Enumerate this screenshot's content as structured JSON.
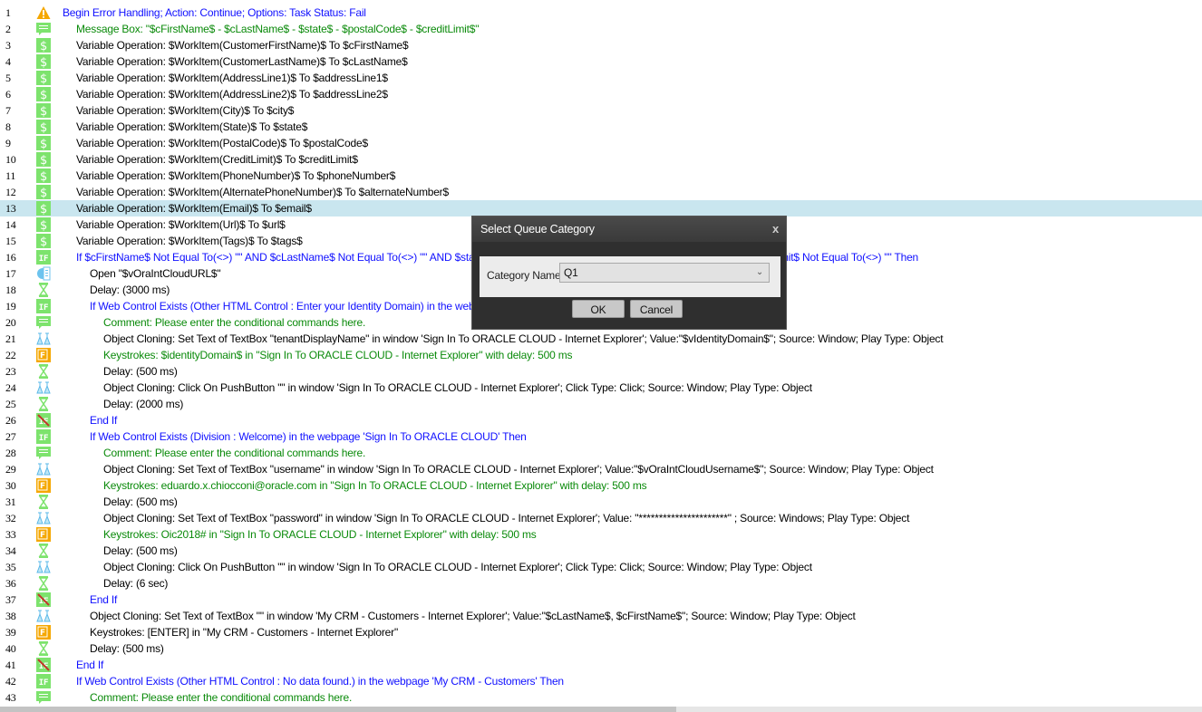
{
  "colors": {
    "blue": "#1010ff",
    "green": "#0a8a0a",
    "selected_row": "#c9e6ef"
  },
  "rows": [
    {
      "n": "1",
      "icon": "warning",
      "indent": 0,
      "color": "blue",
      "text": "Begin Error Handling; Action: Continue; Options:  Task Status: Fail"
    },
    {
      "n": "2",
      "icon": "comment",
      "indent": 1,
      "color": "green",
      "text": "Message Box: \"$cFirstName$ - $cLastName$ - $state$ - $postalCode$ - $creditLimit$\""
    },
    {
      "n": "3",
      "icon": "dollar",
      "indent": 1,
      "color": "black",
      "text": "Variable Operation: $WorkItem(CustomerFirstName)$ To $cFirstName$"
    },
    {
      "n": "4",
      "icon": "dollar",
      "indent": 1,
      "color": "black",
      "text": "Variable Operation: $WorkItem(CustomerLastName)$ To $cLastName$"
    },
    {
      "n": "5",
      "icon": "dollar",
      "indent": 1,
      "color": "black",
      "text": "Variable Operation: $WorkItem(AddressLine1)$ To $addressLine1$"
    },
    {
      "n": "6",
      "icon": "dollar",
      "indent": 1,
      "color": "black",
      "text": "Variable Operation: $WorkItem(AddressLine2)$ To $addressLine2$"
    },
    {
      "n": "7",
      "icon": "dollar",
      "indent": 1,
      "color": "black",
      "text": "Variable Operation: $WorkItem(City)$ To $city$"
    },
    {
      "n": "8",
      "icon": "dollar",
      "indent": 1,
      "color": "black",
      "text": "Variable Operation: $WorkItem(State)$ To $state$"
    },
    {
      "n": "9",
      "icon": "dollar",
      "indent": 1,
      "color": "black",
      "text": "Variable Operation: $WorkItem(PostalCode)$ To $postalCode$"
    },
    {
      "n": "10",
      "icon": "dollar",
      "indent": 1,
      "color": "black",
      "text": "Variable Operation: $WorkItem(CreditLimit)$ To $creditLimit$"
    },
    {
      "n": "11",
      "icon": "dollar",
      "indent": 1,
      "color": "black",
      "text": "Variable Operation: $WorkItem(PhoneNumber)$ To $phoneNumber$"
    },
    {
      "n": "12",
      "icon": "dollar",
      "indent": 1,
      "color": "black",
      "text": "Variable Operation: $WorkItem(AlternatePhoneNumber)$ To $alternateNumber$"
    },
    {
      "n": "13",
      "icon": "dollar",
      "indent": 1,
      "color": "black",
      "text": "Variable Operation: $WorkItem(Email)$ To $email$",
      "selected": true
    },
    {
      "n": "14",
      "icon": "dollar",
      "indent": 1,
      "color": "black",
      "text": "Variable Operation: $WorkItem(Url)$ To $url$"
    },
    {
      "n": "15",
      "icon": "dollar",
      "indent": 1,
      "color": "black",
      "text": "Variable Operation: $WorkItem(Tags)$ To $tags$"
    },
    {
      "n": "16",
      "icon": "if",
      "indent": 1,
      "color": "blue",
      "text": "If $cFirstName$ Not Equal To(<>) \"\" AND $cLastName$ Not Equal To(<>) \"\" AND $state$ N",
      "tail": "mit$ Not Equal To(<>) \"\" Then"
    },
    {
      "n": "17",
      "icon": "open",
      "indent": 2,
      "color": "black",
      "text": "Open \"$vOraIntCloudURL$\""
    },
    {
      "n": "18",
      "icon": "delay",
      "indent": 2,
      "color": "black",
      "text": "Delay: (3000 ms)"
    },
    {
      "n": "19",
      "icon": "if",
      "indent": 2,
      "color": "blue",
      "text": "If Web Control Exists (Other HTML Control : Enter your Identity Domain) in the webpage 'S"
    },
    {
      "n": "20",
      "icon": "comment",
      "indent": 3,
      "color": "green",
      "text": "Comment: Please enter the conditional commands here."
    },
    {
      "n": "21",
      "icon": "clone",
      "indent": 3,
      "color": "black",
      "text": "Object Cloning: Set Text of TextBox \"tenantDisplayName\" in window 'Sign In To ORACLE CLOUD - Internet Explorer'; Value:\"$vIdentityDomain$\"; Source: Window; Play Type: Object"
    },
    {
      "n": "22",
      "icon": "keys",
      "indent": 3,
      "color": "green",
      "text": "Keystrokes: $identityDomain$ in \"Sign In To ORACLE CLOUD - Internet Explorer\" with delay: 500 ms"
    },
    {
      "n": "23",
      "icon": "delay",
      "indent": 3,
      "color": "black",
      "text": "Delay: (500 ms)"
    },
    {
      "n": "24",
      "icon": "clone",
      "indent": 3,
      "color": "black",
      "text": "Object Cloning: Click On PushButton \"\" in window 'Sign In To ORACLE CLOUD - Internet Explorer'; Click Type: Click; Source: Window; Play Type: Object"
    },
    {
      "n": "25",
      "icon": "delay",
      "indent": 3,
      "color": "black",
      "text": "Delay: (2000 ms)"
    },
    {
      "n": "26",
      "icon": "endif",
      "indent": 2,
      "color": "blue",
      "text": "End If"
    },
    {
      "n": "27",
      "icon": "if",
      "indent": 2,
      "color": "blue",
      "text": "If Web Control Exists (Division : Welcome) in the webpage 'Sign In To ORACLE CLOUD' Then"
    },
    {
      "n": "28",
      "icon": "comment",
      "indent": 3,
      "color": "green",
      "text": "Comment: Please enter the conditional commands here."
    },
    {
      "n": "29",
      "icon": "clone",
      "indent": 3,
      "color": "black",
      "text": "Object Cloning: Set Text of TextBox \"username\" in window 'Sign In To ORACLE CLOUD - Internet Explorer'; Value:\"$vOraIntCloudUsername$\"; Source: Window; Play Type: Object"
    },
    {
      "n": "30",
      "icon": "keys",
      "indent": 3,
      "color": "green",
      "text": "Keystrokes: eduardo.x.chiocconi@oracle.com in \"Sign In To ORACLE CLOUD - Internet Explorer\" with delay: 500 ms"
    },
    {
      "n": "31",
      "icon": "delay",
      "indent": 3,
      "color": "black",
      "text": "Delay: (500 ms)"
    },
    {
      "n": "32",
      "icon": "clone",
      "indent": 3,
      "color": "black",
      "text": "Object Cloning: Set Text of TextBox \"password\" in window 'Sign In To ORACLE CLOUD - Internet Explorer'; Value: \"**********************\" ; Source: Windows; Play Type: Object"
    },
    {
      "n": "33",
      "icon": "keys",
      "indent": 3,
      "color": "green",
      "text": "Keystrokes: Oic2018# in \"Sign In To ORACLE CLOUD - Internet Explorer\" with delay: 500 ms"
    },
    {
      "n": "34",
      "icon": "delay",
      "indent": 3,
      "color": "black",
      "text": "Delay: (500 ms)"
    },
    {
      "n": "35",
      "icon": "clone",
      "indent": 3,
      "color": "black",
      "text": "Object Cloning: Click On PushButton \"\" in window 'Sign In To ORACLE CLOUD - Internet Explorer'; Click Type: Click; Source: Window; Play Type: Object"
    },
    {
      "n": "36",
      "icon": "delay",
      "indent": 3,
      "color": "black",
      "text": "Delay: (6 sec)"
    },
    {
      "n": "37",
      "icon": "endif",
      "indent": 2,
      "color": "blue",
      "text": "End If"
    },
    {
      "n": "38",
      "icon": "clone",
      "indent": 2,
      "color": "black",
      "text": "Object Cloning: Set Text of TextBox \"\" in window 'My CRM - Customers - Internet Explorer'; Value:\"$cLastName$, $cFirstName$\"; Source: Window; Play Type: Object"
    },
    {
      "n": "39",
      "icon": "keys",
      "indent": 2,
      "color": "black",
      "text": "Keystrokes: [ENTER] in \"My CRM - Customers - Internet Explorer\""
    },
    {
      "n": "40",
      "icon": "delay",
      "indent": 2,
      "color": "black",
      "text": "Delay: (500 ms)"
    },
    {
      "n": "41",
      "icon": "endif",
      "indent": 1,
      "color": "blue",
      "text": "End If"
    },
    {
      "n": "42",
      "icon": "if",
      "indent": 1,
      "color": "blue",
      "text": "If Web Control Exists (Other HTML Control : No data found.) in the webpage 'My CRM - Customers' Then"
    },
    {
      "n": "43",
      "icon": "comment",
      "indent": 2,
      "color": "green",
      "text": "Comment: Please enter the conditional commands here."
    }
  ],
  "dialog": {
    "title": "Select Queue Category",
    "close": "x",
    "label": "Category Name:",
    "value": "Q1",
    "ok": "OK",
    "cancel": "Cancel"
  }
}
